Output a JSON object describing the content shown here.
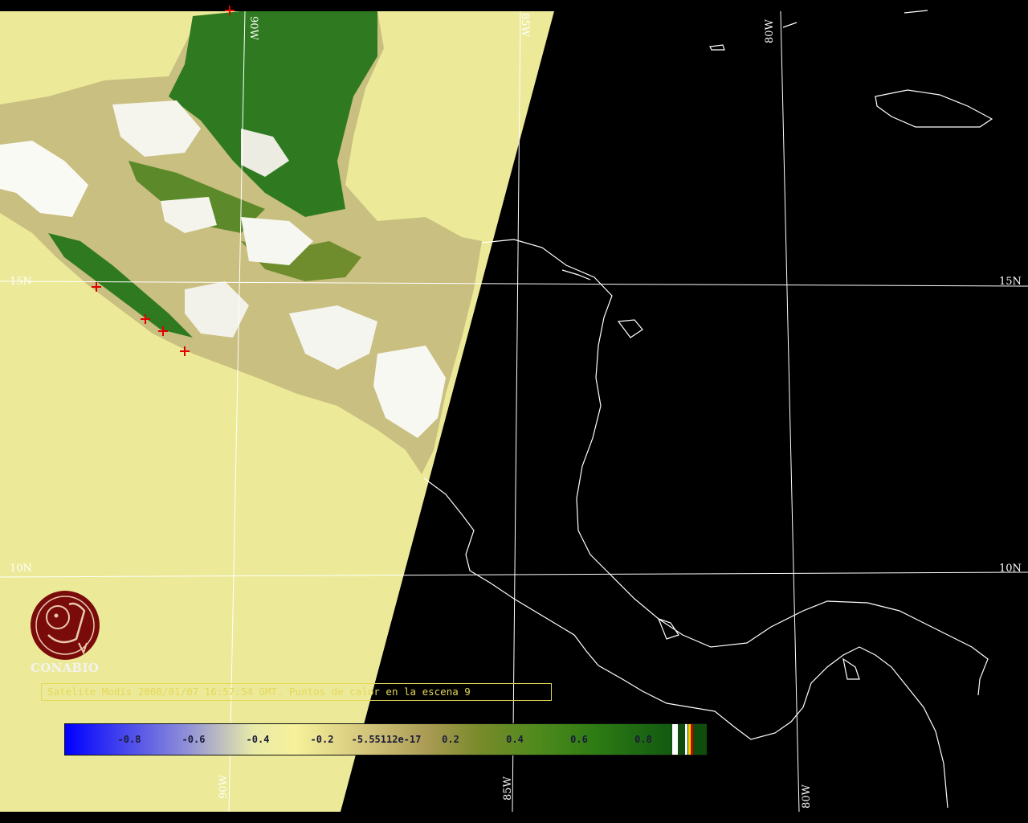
{
  "grid_labels": {
    "lon_90_top": "90W",
    "lon_85_top": "85W",
    "lon_80_top": "80W",
    "lat_15_left": "15N",
    "lat_15_right": "15N",
    "lat_10_left": "10N",
    "lat_10_right": "10N",
    "lon_90_bottom": "90W",
    "lon_85_bottom": "85W",
    "lon_80_bottom": "80W"
  },
  "logo": {
    "text": "CONABIO",
    "icon": "conabio-logo-icon"
  },
  "caption": "Satelite Modis 2008/01/07 16:57:54 GMT. Puntos de calor en la escena 9",
  "colorbar": {
    "ticks": [
      "-0.8",
      "-0.6",
      "-0.4",
      "-0.2",
      "-5.55112e-17",
      "0.2",
      "0.4",
      "0.6",
      "0.8"
    ]
  },
  "hotspots_count": 5,
  "colors": {
    "ocean_in_swath": "#ecea98",
    "outside_swath": "#000000",
    "vegetation": "#2d7a1a",
    "grid": "#ffffff",
    "hotspot": "#e00000",
    "caption": "#e5d85a"
  }
}
